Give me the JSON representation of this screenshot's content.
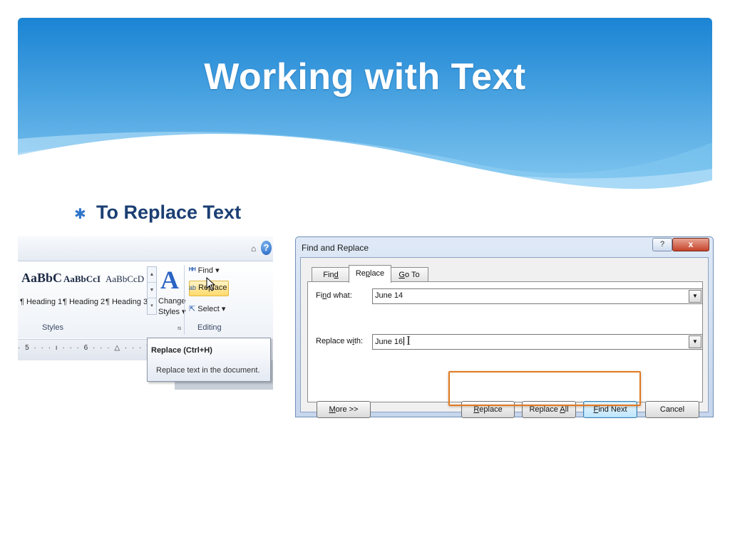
{
  "slide": {
    "title": "Working with Text",
    "bullet": "To Replace Text"
  },
  "ribbon": {
    "styles": [
      {
        "preview": "AaBbC",
        "caption": "¶ Heading 1"
      },
      {
        "preview": "AaBbCcI",
        "caption": "¶ Heading 2"
      },
      {
        "preview": "AaBbCcD",
        "caption": "¶ Heading 3"
      }
    ],
    "change_styles": {
      "line1": "Change",
      "line2": "Styles ▾"
    },
    "editing": {
      "find": "Find ▾",
      "replace": "Replace",
      "select": "Select ▾"
    },
    "group_labels": {
      "styles": "Styles",
      "editing": "Editing"
    },
    "ruler": "· 5 · · · ı · · · 6 · · · △ · · · 7",
    "tooltip": {
      "title": "Replace (Ctrl+H)",
      "description": "Replace text in the document."
    },
    "help_symbol": "?"
  },
  "dialog": {
    "title": "Find and Replace",
    "help_symbol": "?",
    "close_symbol": "x",
    "tabs": [
      {
        "pre": "Fin",
        "key": "d",
        "post": "",
        "active": false
      },
      {
        "pre": "Re",
        "key": "p",
        "post": "lace",
        "active": true
      },
      {
        "pre": "",
        "key": "G",
        "post": "o To",
        "active": false
      }
    ],
    "find_what": {
      "label_pre": "Fi",
      "label_key": "n",
      "label_post": "d what:",
      "value": "June 14"
    },
    "replace_with": {
      "label_pre": "Replace w",
      "label_key": "i",
      "label_post": "th:",
      "value": "June 16"
    },
    "buttons": {
      "more": {
        "key": "M",
        "rest": "ore >>"
      },
      "replace": {
        "key": "R",
        "rest": "eplace"
      },
      "replace_all": {
        "pre": "Replace ",
        "key": "A",
        "rest": "ll"
      },
      "find_next": {
        "key": "F",
        "rest": "ind Next"
      },
      "cancel": "Cancel"
    }
  },
  "colors": {
    "banner_top": "#1a84d4",
    "banner_bottom": "#8ecff3",
    "title_text": "#ffffff",
    "bullet_text": "#1b3f73",
    "bullet_marker": "#2e74c9",
    "highlight_box": "#e07a22",
    "dialog_close": "#c6432a"
  }
}
